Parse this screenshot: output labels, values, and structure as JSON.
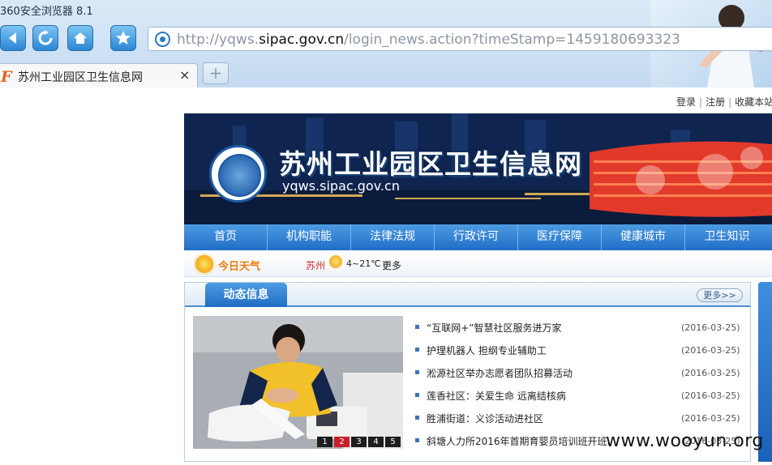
{
  "browser": {
    "title": "360安全浏览器 8.1",
    "address": {
      "prefix": "http://yqws.",
      "domain": "sipac.gov.cn",
      "path": "/login_news.action?timeStamp=1459180693323"
    },
    "tab": {
      "icon": "F",
      "title": "苏州工业园区卫生信息网",
      "close": "×"
    },
    "new_tab": "+"
  },
  "top_links": [
    "登录",
    "注册",
    "收藏本站"
  ],
  "banner": {
    "site_name": "苏州工业园区卫生信息网",
    "domain": "yqws.sipac.gov.cn"
  },
  "nav": [
    "首页",
    "机构职能",
    "法律法规",
    "行政许可",
    "医疗保障",
    "健康城市",
    "卫生知识"
  ],
  "weather": {
    "label": "今日天气",
    "city": "苏州",
    "temp": "4~21℃",
    "more": "更多"
  },
  "news": {
    "title": "动态信息",
    "more": "更多>>",
    "slideshow_pages": [
      "1",
      "2",
      "3",
      "4",
      "5"
    ],
    "active_page": 2,
    "items": [
      {
        "title": "“互联网+”智慧社区服务进万家",
        "date": "(2016-03-25)"
      },
      {
        "title": "护理机器人 担纲专业辅助工",
        "date": "(2016-03-25)"
      },
      {
        "title": "淞源社区举办志愿者团队招募活动",
        "date": "(2016-03-25)"
      },
      {
        "title": "莲香社区：关爱生命 远离结核病",
        "date": "(2016-03-25)"
      },
      {
        "title": "胜浦街道：义诊活动进社区",
        "date": "(2016-03-25)"
      },
      {
        "title": "斜塘人力所2016年首期育婴员培训班开班……",
        "date": "(2016-03-25)"
      }
    ]
  },
  "watermark": "www.wooyun.org"
}
